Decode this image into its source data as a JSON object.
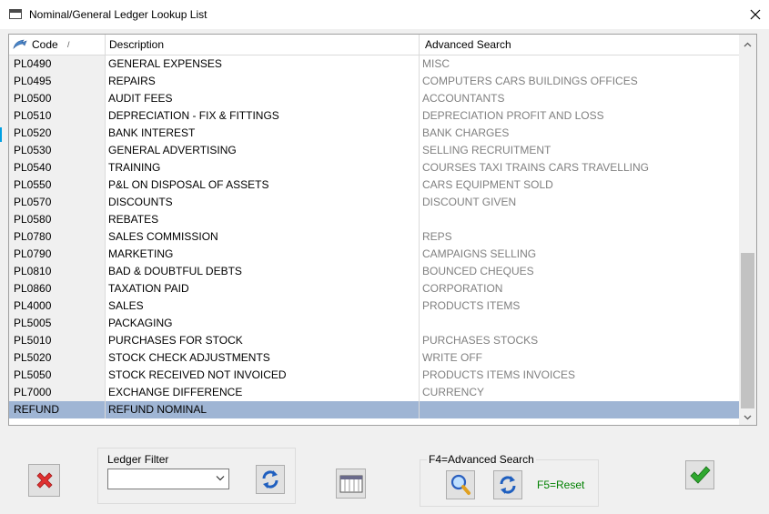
{
  "window": {
    "title": "Nominal/General Ledger Lookup List"
  },
  "grid": {
    "columns": {
      "code": "Code",
      "description": "Description",
      "advanced": "Advanced Search"
    },
    "sort_indicator": "/",
    "rows": [
      {
        "code": "PL0490",
        "desc": "GENERAL EXPENSES",
        "adv": "MISC"
      },
      {
        "code": "PL0495",
        "desc": "REPAIRS",
        "adv": "COMPUTERS CARS BUILDINGS OFFICES"
      },
      {
        "code": "PL0500",
        "desc": "AUDIT FEES",
        "adv": "ACCOUNTANTS"
      },
      {
        "code": "PL0510",
        "desc": "DEPRECIATION - FIX & FITTINGS",
        "adv": "DEPRECIATION PROFIT AND LOSS"
      },
      {
        "code": "PL0520",
        "desc": "BANK INTEREST",
        "adv": "BANK CHARGES"
      },
      {
        "code": "PL0530",
        "desc": "GENERAL ADVERTISING",
        "adv": "SELLING RECRUITMENT"
      },
      {
        "code": "PL0540",
        "desc": "TRAINING",
        "adv": "COURSES TAXI TRAINS CARS TRAVELLING"
      },
      {
        "code": "PL0550",
        "desc": "P&L ON DISPOSAL OF ASSETS",
        "adv": "CARS EQUIPMENT SOLD"
      },
      {
        "code": "PL0570",
        "desc": "DISCOUNTS",
        "adv": "DISCOUNT GIVEN"
      },
      {
        "code": "PL0580",
        "desc": "REBATES",
        "adv": ""
      },
      {
        "code": "PL0780",
        "desc": "SALES COMMISSION",
        "adv": "REPS"
      },
      {
        "code": "PL0790",
        "desc": "MARKETING",
        "adv": "CAMPAIGNS SELLING"
      },
      {
        "code": "PL0810",
        "desc": "BAD & DOUBTFUL DEBTS",
        "adv": "BOUNCED CHEQUES"
      },
      {
        "code": "PL0860",
        "desc": "TAXATION PAID",
        "adv": "CORPORATION"
      },
      {
        "code": "PL4000",
        "desc": "SALES",
        "adv": "PRODUCTS ITEMS"
      },
      {
        "code": "PL5005",
        "desc": "PACKAGING",
        "adv": ""
      },
      {
        "code": "PL5010",
        "desc": "PURCHASES FOR STOCK",
        "adv": "PURCHASES STOCKS"
      },
      {
        "code": "PL5020",
        "desc": "STOCK CHECK ADJUSTMENTS",
        "adv": "WRITE OFF"
      },
      {
        "code": "PL5050",
        "desc": "STOCK RECEIVED NOT INVOICED",
        "adv": "PRODUCTS ITEMS INVOICES"
      },
      {
        "code": "PL7000",
        "desc": "EXCHANGE DIFFERENCE",
        "adv": "CURRENCY"
      },
      {
        "code": "REFUND",
        "desc": "REFUND NOMINAL",
        "adv": "",
        "selected": true
      }
    ]
  },
  "footer": {
    "ledger_filter_label": "Ledger Filter",
    "ledger_filter_value": "",
    "advanced_search_label": "F4=Advanced Search",
    "reset_label": "F5=Reset"
  },
  "icons": {
    "cancel": "cancel-x-icon",
    "refresh": "refresh-icon",
    "columns": "columns-icon",
    "search": "magnifier-icon",
    "ok": "checkmark-icon"
  },
  "colors": {
    "selected_row": "#9fb5d4",
    "muted_text": "#808080",
    "reset_text": "#008000",
    "cancel_red": "#e03030",
    "ok_green": "#2fa82f",
    "refresh_blue": "#1f5fbf"
  }
}
